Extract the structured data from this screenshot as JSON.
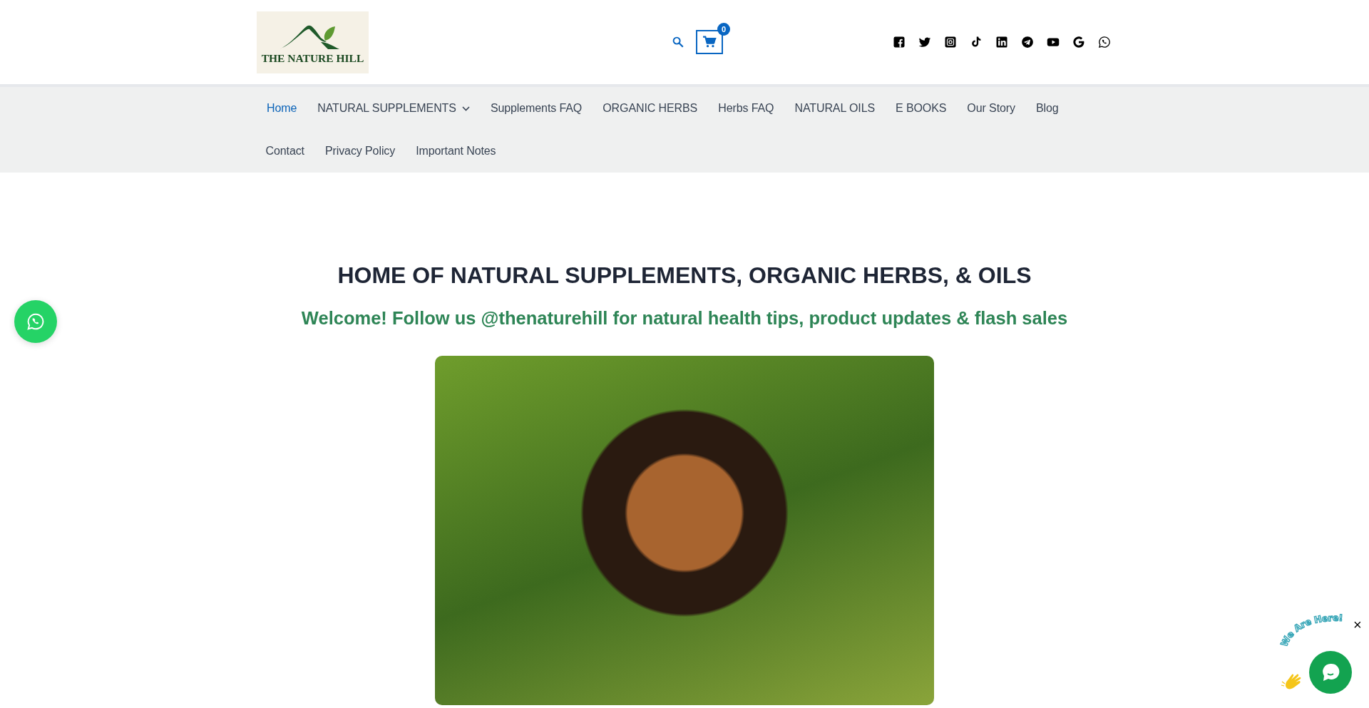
{
  "header": {
    "logo_text": "THE NATURE HILL",
    "cart_count": "0"
  },
  "nav": {
    "items": [
      {
        "label": "Home",
        "selected": true,
        "has_submenu": false
      },
      {
        "label": "NATURAL SUPPLEMENTS",
        "selected": false,
        "has_submenu": true
      },
      {
        "label": "Supplements FAQ",
        "selected": false,
        "has_submenu": false
      },
      {
        "label": "ORGANIC HERBS",
        "selected": false,
        "has_submenu": false
      },
      {
        "label": "Herbs FAQ",
        "selected": false,
        "has_submenu": false
      },
      {
        "label": "NATURAL OILS",
        "selected": false,
        "has_submenu": false
      },
      {
        "label": "E BOOKS",
        "selected": false,
        "has_submenu": false
      },
      {
        "label": "Our Story",
        "selected": false,
        "has_submenu": false
      },
      {
        "label": "Blog",
        "selected": false,
        "has_submenu": false
      },
      {
        "label": "Contact",
        "selected": false,
        "has_submenu": false
      },
      {
        "label": "Privacy Policy",
        "selected": false,
        "has_submenu": false
      },
      {
        "label": "Important Notes",
        "selected": false,
        "has_submenu": false
      }
    ]
  },
  "hero": {
    "title": "HOME OF NATURAL SUPPLEMENTS, ORGANIC HERBS, & OILS",
    "subtitle": "Welcome! Follow us @thenaturehill for natural health tips, product updates & flash sales"
  },
  "chat_widget": {
    "greeting": "We Are Here!",
    "close": "×"
  }
}
